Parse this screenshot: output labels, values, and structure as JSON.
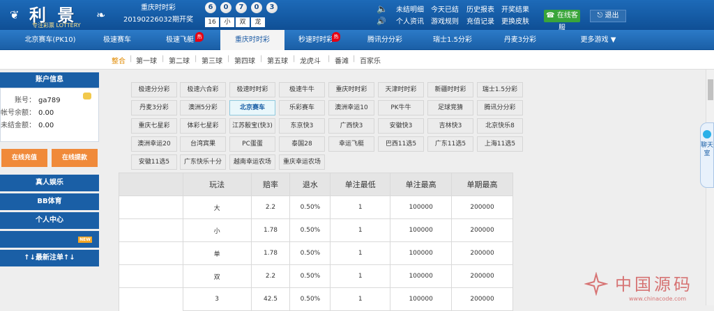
{
  "logo": {
    "brand": "利 景",
    "slogan": "专注彩票 LOTTERY"
  },
  "draw": {
    "game": "重庆时时彩",
    "period": "20190226032期开奖",
    "balls": [
      "6",
      "0",
      "7",
      "0",
      "3"
    ],
    "tags": [
      "16",
      "小",
      "双",
      "龙"
    ]
  },
  "top_links": [
    "未结明细",
    "今天已结",
    "历史报表",
    "开奖结果",
    "个人资讯",
    "游戏规则",
    "充值记录",
    "更换皮肤"
  ],
  "service_label": "在线客服",
  "exit_label": "退出",
  "nav": [
    {
      "label": "北京赛车(PK10)",
      "hot": false
    },
    {
      "label": "极速赛车",
      "hot": false
    },
    {
      "label": "极速飞艇",
      "hot": true
    },
    {
      "label": "重庆时时彩",
      "hot": false,
      "active": true
    },
    {
      "label": "秒速时时彩",
      "hot": true
    },
    {
      "label": "腾讯分分彩",
      "hot": false
    },
    {
      "label": "瑞士1.5分彩",
      "hot": false
    },
    {
      "label": "丹麦3分彩",
      "hot": false
    },
    {
      "label": "更多游戏 ▼",
      "hot": false
    }
  ],
  "hot_label": "热",
  "subnav": [
    "整合",
    "第一球",
    "第二球",
    "第三球",
    "第四球",
    "第五球",
    "龙虎斗",
    "番滩",
    "百家乐"
  ],
  "account": {
    "title": "账户信息",
    "rows": [
      {
        "k": "账号：",
        "v": "ga789"
      },
      {
        "k": "帐号余额：",
        "v": "0.00"
      },
      {
        "k": "未结金额：",
        "v": "0.00"
      }
    ]
  },
  "side_buttons": [
    "在线充值",
    "在线提款"
  ],
  "side_bars": [
    "真人娱乐",
    "BB体育",
    "个人中心",
    "",
    "↑↓最新注单↑↓"
  ],
  "new_label": "NEW",
  "games": [
    [
      "极速分分彩",
      "极速六合彩",
      "极速时时彩",
      "极速牛牛",
      "重庆时时彩",
      "天津时时彩",
      "新疆时时彩",
      "瑞士1.5分彩"
    ],
    [
      "丹麦3分彩",
      "澳洲5分彩",
      "北京赛车",
      "乐彩赛车",
      "澳洲幸运10",
      "PK牛牛",
      "足球竞猜",
      "腾讯分分彩"
    ],
    [
      "重庆七星彩",
      "体彩七星彩",
      "江苏骰宝(快3)",
      "东京快3",
      "广西快3",
      "安徽快3",
      "吉林快3",
      "北京快乐8"
    ],
    [
      "澳洲幸运20",
      "台湾宾果",
      "PC蛋蛋",
      "泰国28",
      "幸运飞艇",
      "巴西11选5",
      "广东11选5",
      "上海11选5"
    ],
    [
      "安徽11选5",
      "广东快乐十分",
      "越南幸运农场",
      "重庆幸运农场"
    ]
  ],
  "table": {
    "headers": [
      "玩法",
      "赔率",
      "退水",
      "单注最低",
      "单注最高",
      "单期最高"
    ],
    "rows": [
      [
        "大",
        "2.2",
        "0.50%",
        "1",
        "100000",
        "200000"
      ],
      [
        "小",
        "1.78",
        "0.50%",
        "1",
        "100000",
        "200000"
      ],
      [
        "单",
        "1.78",
        "0.50%",
        "1",
        "100000",
        "200000"
      ],
      [
        "双",
        "2.2",
        "0.50%",
        "1",
        "100000",
        "200000"
      ],
      [
        "3",
        "42.5",
        "0.50%",
        "1",
        "100000",
        "200000"
      ]
    ]
  },
  "chat": {
    "label": "聊天室"
  },
  "watermark": {
    "title": "中国源码",
    "url": "www.chinacode.com"
  }
}
